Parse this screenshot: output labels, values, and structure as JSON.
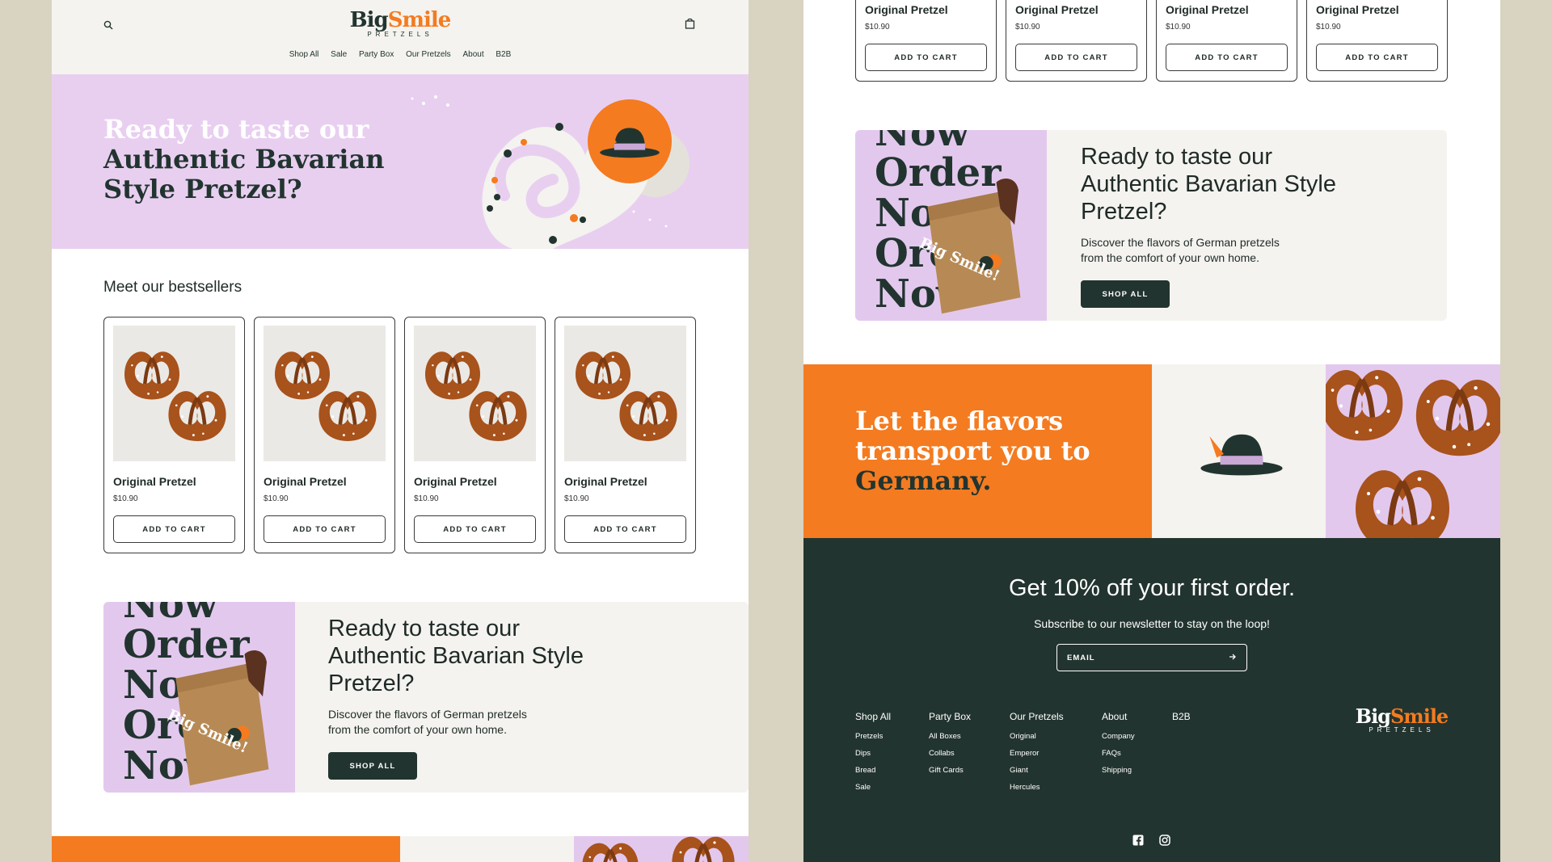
{
  "brand": {
    "big": "Big",
    "smile": "Smile",
    "sub": "PRETZELS"
  },
  "nav": [
    "Shop All",
    "Sale",
    "Party Box",
    "Our Pretzels",
    "About",
    "B2B"
  ],
  "hero": {
    "line1": "Ready to taste our",
    "line2": "Authentic Bavarian",
    "line3": "Style Pretzel?"
  },
  "bestsellers": {
    "title": "Meet our bestsellers"
  },
  "products": [
    {
      "name": "Original Pretzel",
      "price": "$10.90",
      "button": "ADD TO CART"
    },
    {
      "name": "Original Pretzel",
      "price": "$10.90",
      "button": "ADD TO CART"
    },
    {
      "name": "Original Pretzel",
      "price": "$10.90",
      "button": "ADD TO CART"
    },
    {
      "name": "Original Pretzel",
      "price": "$10.90",
      "button": "ADD TO CART"
    }
  ],
  "promo": {
    "title_1": "Ready to taste our",
    "title_2": "Authentic Bavarian Style",
    "title_3": "Pretzel?",
    "desc_1": "Discover the flavors of German pretzels",
    "desc_2": "from the comfort of your own home.",
    "button": "SHOP ALL",
    "bag_text": "Big Smile!",
    "bg_words": [
      "Now",
      "Order",
      "Now",
      "Order",
      "Now"
    ]
  },
  "flavors": {
    "line1": "Let the flavors",
    "line2": "transport you to",
    "line3": "Germany."
  },
  "newsletter": {
    "heading": "Get 10% off your first order.",
    "subtext": "Subscribe to our newsletter to stay on the loop!",
    "email_label": "EMAIL",
    "submit_icon": "arrow-right-icon"
  },
  "footer_cols": [
    {
      "title": "Shop All",
      "items": [
        "Pretzels",
        "Dips",
        "Bread",
        "Sale"
      ]
    },
    {
      "title": "Party Box",
      "items": [
        "All Boxes",
        "Collabs",
        "Gift Cards"
      ]
    },
    {
      "title": "Our Pretzels",
      "items": [
        "Original",
        "Emperor",
        "Giant",
        "Hercules"
      ]
    },
    {
      "title": "About",
      "items": [
        "Company",
        "FAQs",
        "Shipping"
      ]
    },
    {
      "title": "B2B",
      "items": []
    }
  ],
  "social": [
    "facebook-icon",
    "instagram-icon"
  ],
  "icons": {
    "search": "search-icon",
    "cart": "shopping-bag-icon"
  },
  "colors": {
    "dark_green": "#22342f",
    "orange": "#f47b20",
    "lilac": "#e8cff0",
    "cream": "#f4f3ef",
    "backdrop": "#d9d3c1"
  }
}
